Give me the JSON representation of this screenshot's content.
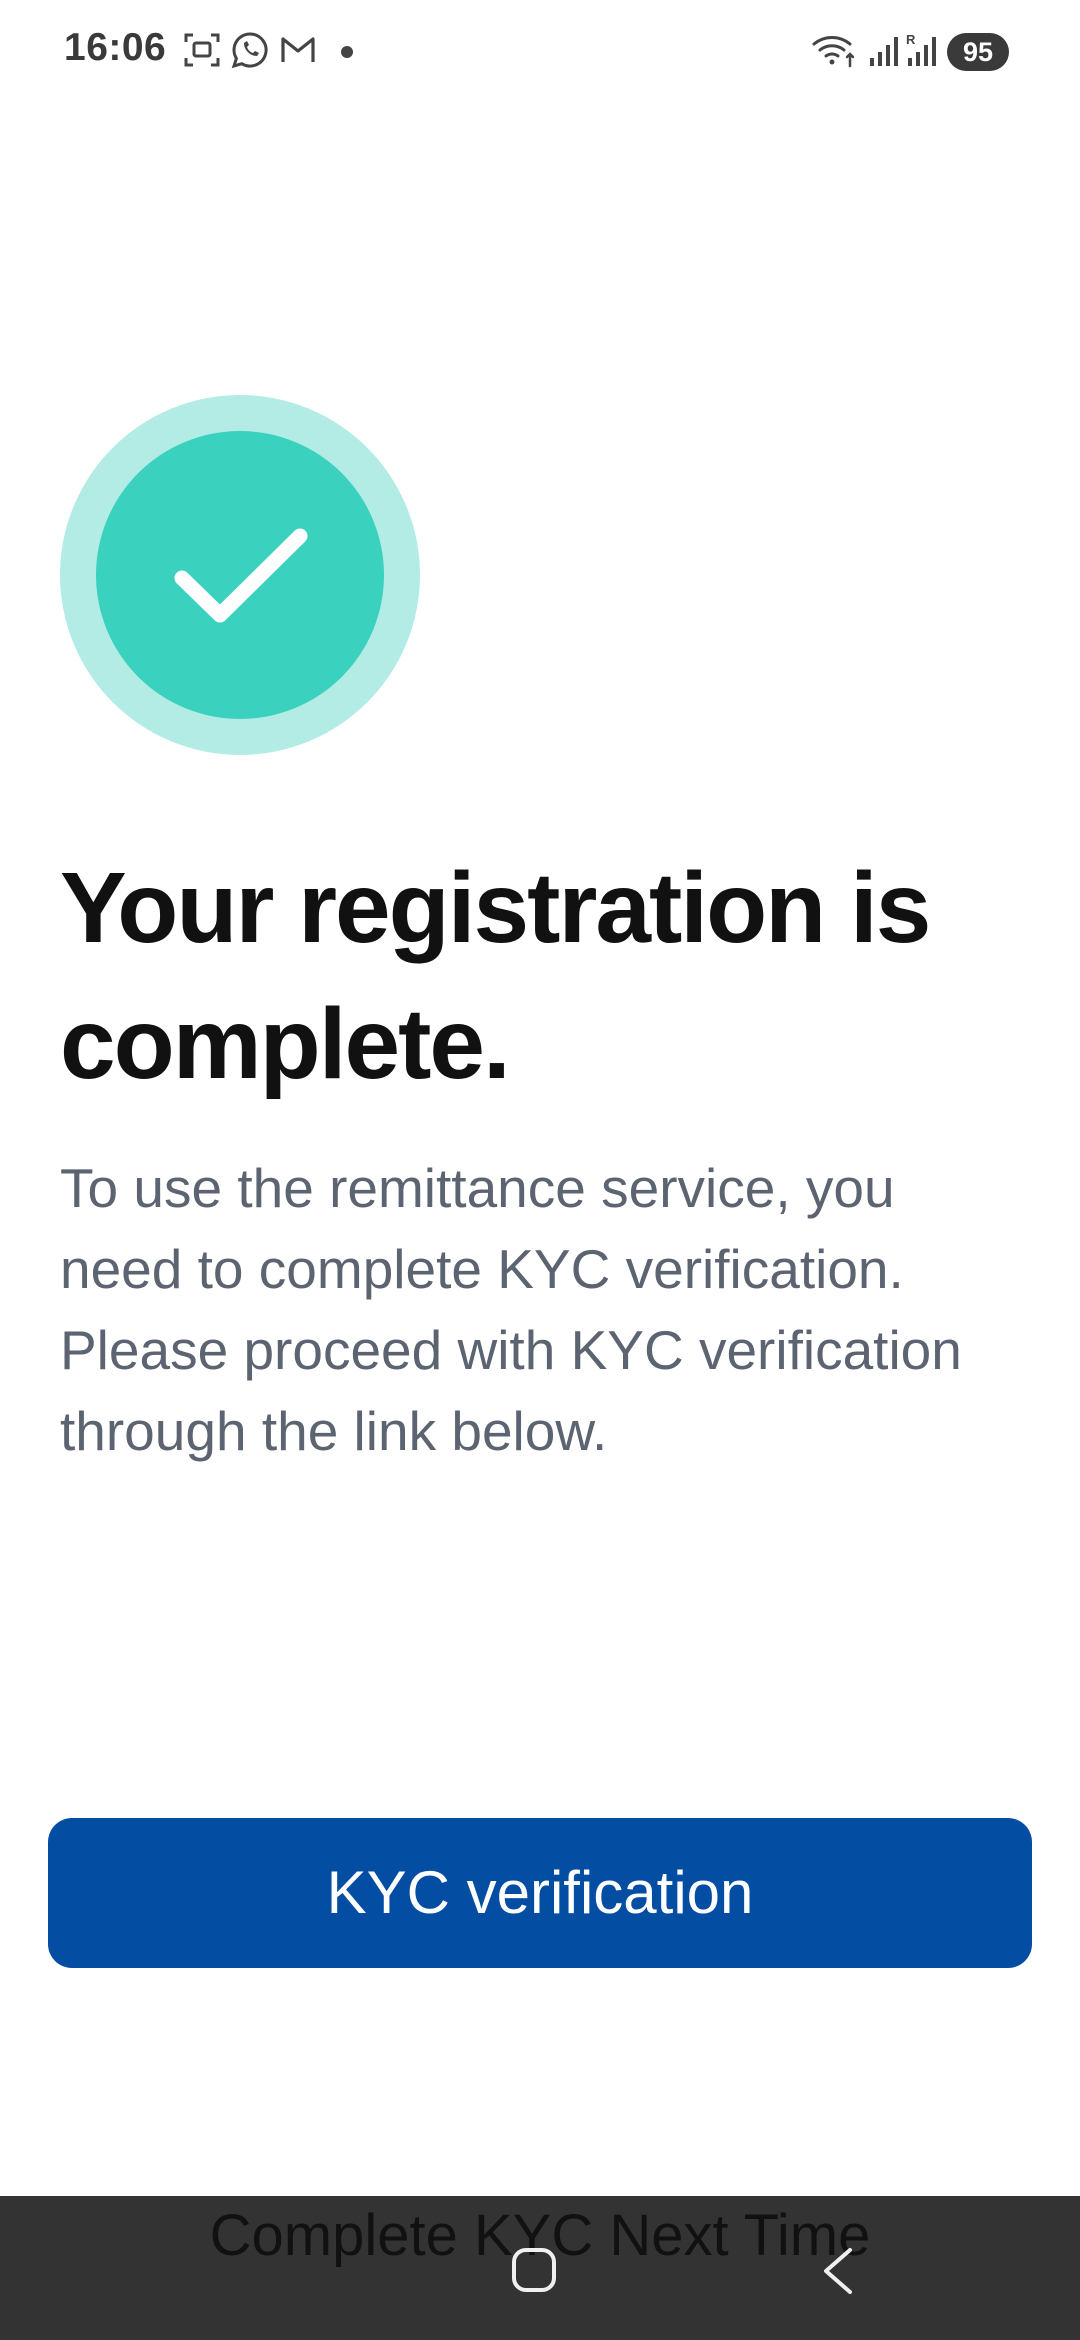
{
  "status_bar": {
    "time": "16:06",
    "notification_icons": [
      "screenshot-icon",
      "whatsapp-icon",
      "gmail-icon",
      "dot-icon"
    ],
    "system_icons": [
      "wifi-icon",
      "signal-icon",
      "signal-roaming-icon"
    ],
    "battery": "95"
  },
  "success": {
    "icon": "checkmark-circle-icon",
    "colors": {
      "outer_ring": "#b3ece4",
      "inner_circle": "#3bd1bf",
      "check": "#ffffff"
    }
  },
  "headline": "Your registration is complete.",
  "description": "To use the remittance service, you need to complete KYC verification. Please proceed with KYC verification through the link below.",
  "primary_button": {
    "label": "KYC verification",
    "color": "#034ea2"
  },
  "secondary_link": {
    "label": "Complete KYC Next Time"
  },
  "nav_bar": {
    "buttons": [
      "home-icon",
      "back-icon"
    ]
  }
}
